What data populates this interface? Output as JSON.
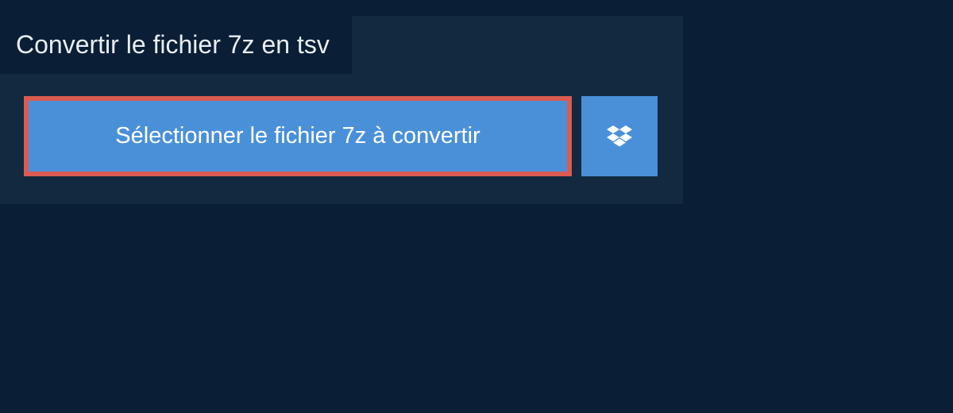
{
  "header": {
    "title": "Convertir le fichier 7z en tsv"
  },
  "actions": {
    "select_file_label": "Sélectionner le fichier 7z à convertir"
  },
  "colors": {
    "page_bg": "#0a1e35",
    "panel_bg": "#12293f",
    "button_bg": "#4a90d9",
    "highlight_border": "#d95b52"
  }
}
